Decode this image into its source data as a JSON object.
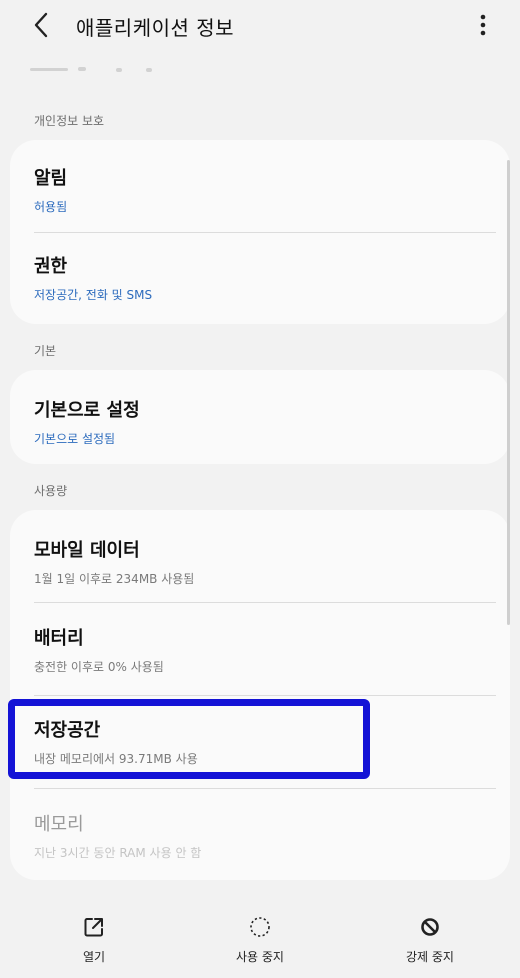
{
  "header": {
    "title": "애플리케이션 정보",
    "back_icon": "chevron-left-icon",
    "more_icon": "more-vertical-icon"
  },
  "sections": {
    "privacy": "개인정보 보호",
    "default": "기본",
    "usage": "사용량"
  },
  "items": {
    "notifications": {
      "title": "알림",
      "subtitle": "허용됨"
    },
    "permissions": {
      "title": "권한",
      "subtitle": "저장공간, 전화 및 SMS"
    },
    "set_default": {
      "title": "기본으로 설정",
      "subtitle": "기본으로 설정됨"
    },
    "mobile_data": {
      "title": "모바일 데이터",
      "subtitle": "1월 1일 이후로 234MB 사용됨"
    },
    "battery": {
      "title": "배터리",
      "subtitle": "충전한 이후로 0% 사용됨"
    },
    "storage": {
      "title": "저장공간",
      "subtitle": "내장 메모리에서 93.71MB 사용"
    },
    "memory": {
      "title": "메모리",
      "subtitle": "지난 3시간 동안 RAM 사용 안 함"
    }
  },
  "bottom_bar": {
    "open": {
      "label": "열기",
      "icon": "open-external-icon"
    },
    "disable": {
      "label": "사용 중지",
      "icon": "dashed-circle-icon"
    },
    "force_stop": {
      "label": "강제 중지",
      "icon": "stop-circle-icon"
    }
  },
  "colors": {
    "accent_blue": "#2c6bbd",
    "highlight": "#1413d6"
  }
}
